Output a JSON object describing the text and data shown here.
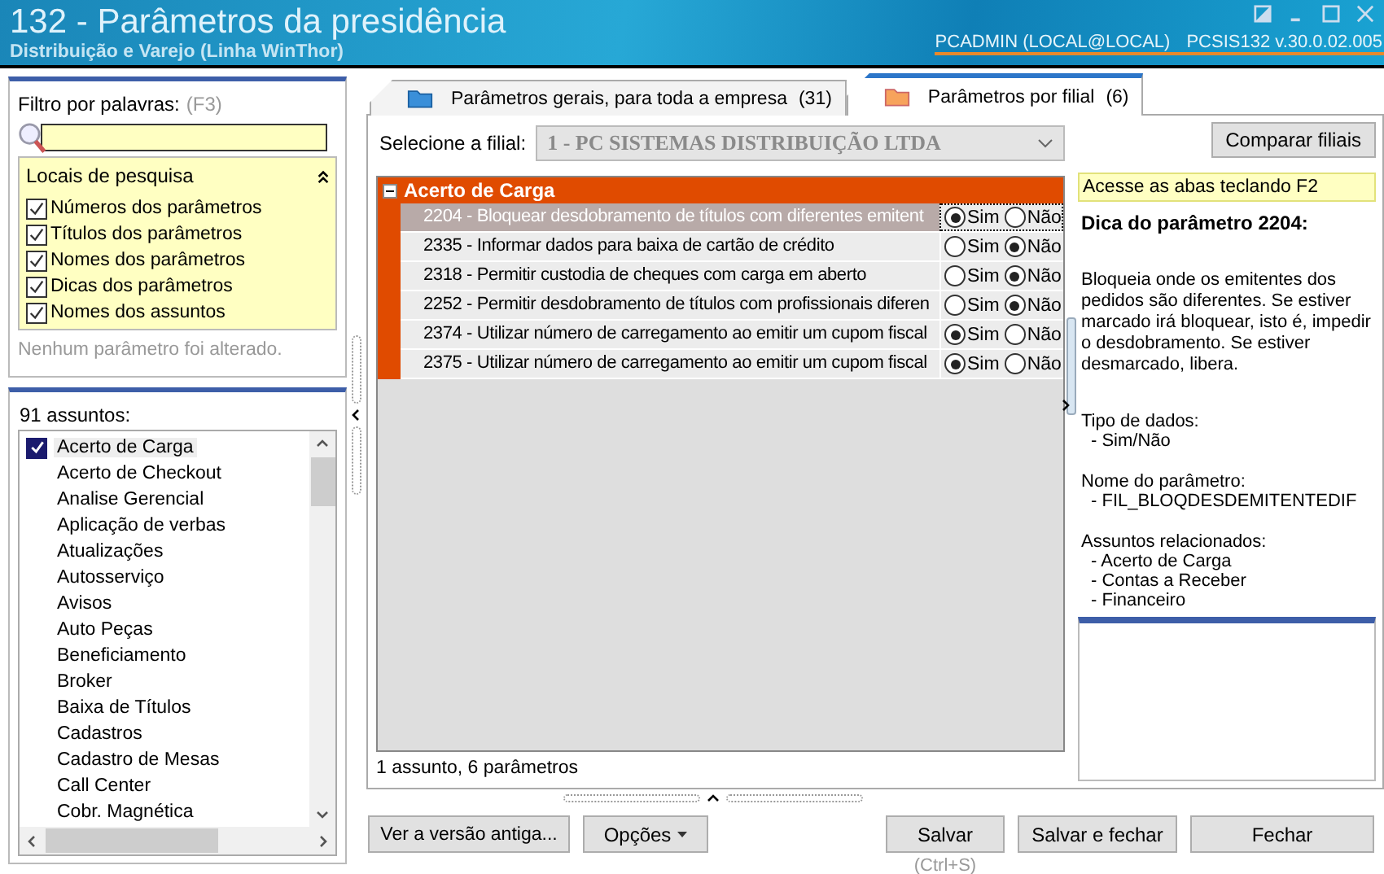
{
  "window": {
    "title": "132 - Parâmetros da presidência",
    "subtitle": "Distribuição e Varejo (Linha WinThor)",
    "user": "PCADMIN (LOCAL@LOCAL)",
    "version": "PCSIS132  v.30.0.02.005"
  },
  "filter": {
    "label": "Filtro por palavras:",
    "shortcut": "(F3)",
    "search_places": {
      "title": "Locais de pesquisa",
      "expanded": true,
      "options": [
        {
          "label": "Números dos parâmetros",
          "checked": true
        },
        {
          "label": "Títulos dos parâmetros",
          "checked": true
        },
        {
          "label": "Nomes dos parâmetros",
          "checked": true
        },
        {
          "label": "Dicas dos parâmetros",
          "checked": true
        },
        {
          "label": "Nomes dos assuntos",
          "checked": true
        }
      ]
    },
    "status": "Nenhum parâmetro foi alterado."
  },
  "subjects": {
    "count_label": "91 assuntos:",
    "items": [
      {
        "label": "Acerto de Carga",
        "checked": true
      },
      {
        "label": "Acerto de Checkout",
        "checked": false
      },
      {
        "label": "Analise Gerencial",
        "checked": false
      },
      {
        "label": "Aplicação de verbas",
        "checked": false
      },
      {
        "label": "Atualizações",
        "checked": false
      },
      {
        "label": "Autosserviço",
        "checked": false
      },
      {
        "label": "Avisos",
        "checked": false
      },
      {
        "label": "Auto Peças",
        "checked": false
      },
      {
        "label": "Beneficiamento",
        "checked": false
      },
      {
        "label": "Broker",
        "checked": false
      },
      {
        "label": "Baixa de Títulos",
        "checked": false
      },
      {
        "label": "Cadastros",
        "checked": false
      },
      {
        "label": "Cadastro de Mesas",
        "checked": false
      },
      {
        "label": "Call Center",
        "checked": false
      },
      {
        "label": "Cobr. Magnética",
        "checked": false
      }
    ]
  },
  "tabs": [
    {
      "label": "Parâmetros gerais, para toda a empresa",
      "count": "(31)",
      "selected": false
    },
    {
      "label": "Parâmetros por filial",
      "count": "(6)",
      "selected": true
    }
  ],
  "branch": {
    "label": "Selecione a filial:",
    "value": "1 - PC SISTEMAS DISTRIBUIÇÃO LTDA",
    "compare_button": "Comparar filiais"
  },
  "parameters": {
    "group": {
      "title": "Acerto de Carga",
      "expanded": true
    },
    "rows": [
      {
        "text": "2204 - Bloquear desdobramento de títulos com diferentes emitent",
        "selected": true,
        "options": [
          {
            "label": "Sim",
            "selected": true
          },
          {
            "label": "Não",
            "selected": false
          }
        ]
      },
      {
        "text": "2335 - Informar dados para baixa de cartão de crédito",
        "selected": false,
        "options": [
          {
            "label": "Sim",
            "selected": false
          },
          {
            "label": "Não",
            "selected": true
          }
        ]
      },
      {
        "text": "2318 - Permitir custodia de cheques com carga em aberto",
        "selected": false,
        "options": [
          {
            "label": "Sim",
            "selected": false
          },
          {
            "label": "Não",
            "selected": true
          }
        ]
      },
      {
        "text": "2252 - Permitir desdobramento de títulos com profissionais diferen",
        "selected": false,
        "options": [
          {
            "label": "Sim",
            "selected": false
          },
          {
            "label": "Não",
            "selected": true
          }
        ]
      },
      {
        "text": "2374 - Utilizar número de carregamento ao emitir um cupom fiscal",
        "selected": false,
        "options": [
          {
            "label": "Sim",
            "selected": true
          },
          {
            "label": "Não",
            "selected": false
          }
        ]
      },
      {
        "text": "2375 - Utilizar número de carregamento ao emitir um cupom fiscal",
        "selected": false,
        "options": [
          {
            "label": "Sim",
            "selected": true
          },
          {
            "label": "Não",
            "selected": false
          }
        ]
      }
    ],
    "status": "1 assunto, 6 parâmetros"
  },
  "tip": {
    "hint": "Acesse as abas teclando F2",
    "title": "Dica do parâmetro 2204:",
    "description": "Bloqueia onde os emitentes dos pedidos são diferentes. Se estiver marcado irá bloquear, isto é, impedir o desdobramento. Se estiver desmarcado, libera.",
    "data_type_label": "Tipo de dados:",
    "data_type": "- Sim/Não",
    "name_label": "Nome do parâmetro:",
    "name": "- FIL_BLOQDESDEMITENTEDIF",
    "related_label": "Assuntos relacionados:",
    "related": [
      "- Acerto de Carga",
      "- Contas a Receber",
      "- Financeiro"
    ]
  },
  "buttons": {
    "old_version": "Ver a versão antiga...",
    "options": "Opções",
    "save": "Salvar",
    "save_shortcut": "(Ctrl+S)",
    "save_close": "Salvar e fechar",
    "close": "Fechar"
  }
}
